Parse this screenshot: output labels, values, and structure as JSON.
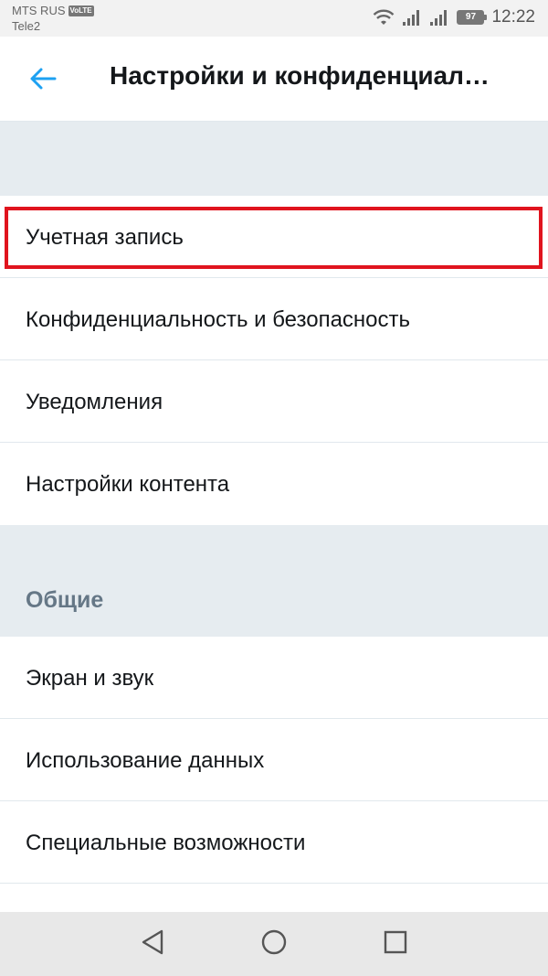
{
  "status_bar": {
    "carrier_primary": "MTS RUS",
    "volte_badge": "VoLTE",
    "carrier_secondary": "Tele2",
    "battery_level": "97",
    "time": "12:22"
  },
  "app_bar": {
    "title": "Настройки и конфиденциал…",
    "accent_color": "#1da1f2"
  },
  "account_section": {
    "items": [
      {
        "label": "Учетная запись"
      },
      {
        "label": "Конфиденциальность и безопасность"
      },
      {
        "label": "Уведомления"
      },
      {
        "label": "Настройки контента"
      }
    ]
  },
  "general_section": {
    "header": "Общие",
    "items": [
      {
        "label": "Экран и звук"
      },
      {
        "label": "Использование данных"
      },
      {
        "label": "Специальные возможности"
      }
    ]
  },
  "highlight_color": "#e0141e",
  "nav_bar": {
    "icons": [
      "back-triangle-icon",
      "home-circle-icon",
      "recents-square-icon"
    ]
  }
}
